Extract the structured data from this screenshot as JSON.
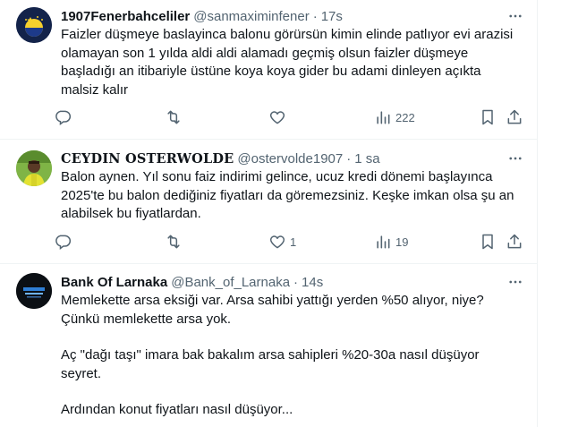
{
  "tweets": [
    {
      "name": "1907Fenerbahceliler",
      "handle": "@sanmaximinfener",
      "time": "17s",
      "lines": [
        "Faizler düşmeye baslayinca balonu görürsün kimin elinde patlıyor evi arazisi",
        "olamayan son 1 yılda aldi aldi alamadı geçmiş olsun faizler düşmeye",
        "başladığı an itibariyle üstüne koya koya gider bu adami dinleyen açıkta",
        "malsiz kalır"
      ],
      "replies": "",
      "retweets": "",
      "likes": "",
      "views": "222"
    },
    {
      "name": "CEYDIN OSTERWOLDE",
      "handle": "@ostervolde1907",
      "time": "1 sa",
      "lines": [
        "Balon aynen. Yıl sonu faiz indirimi gelince, ucuz kredi dönemi başlayınca",
        "2025'te bu balon dediğiniz fiyatları da göremezsiniz. Keşke imkan olsa şu an",
        "alabilsek bu fiyatlardan."
      ],
      "replies": "",
      "retweets": "",
      "likes": "1",
      "views": "19"
    },
    {
      "name": "Bank Of Larnaka",
      "handle": "@Bank_of_Larnaka",
      "time": "14s",
      "paragraphs": [
        "Memlekette arsa eksiği var. Arsa sahibi yattığı yerden %50 alıyor, niye?\nÇünkü memlekette arsa yok.",
        "Aç \"dağı taşı\" imara bak bakalım arsa sahipleri %20-30a nasıl düşüyor\nseyret.",
        "Ardından konut fiyatları nasıl düşüyor..."
      ]
    }
  ],
  "dot": "·",
  "icons": {
    "more": "more-dots-icon",
    "reply": "reply-icon",
    "retweet": "retweet-icon",
    "like": "heart-icon",
    "views": "views-icon",
    "bookmark": "bookmark-icon",
    "share": "share-icon"
  },
  "colors": {
    "text": "#0f1419",
    "muted": "#536471",
    "border": "#eff3f4",
    "fenerbahce_navy": "#13234a",
    "fenerbahce_yellow": "#f6d02d"
  }
}
